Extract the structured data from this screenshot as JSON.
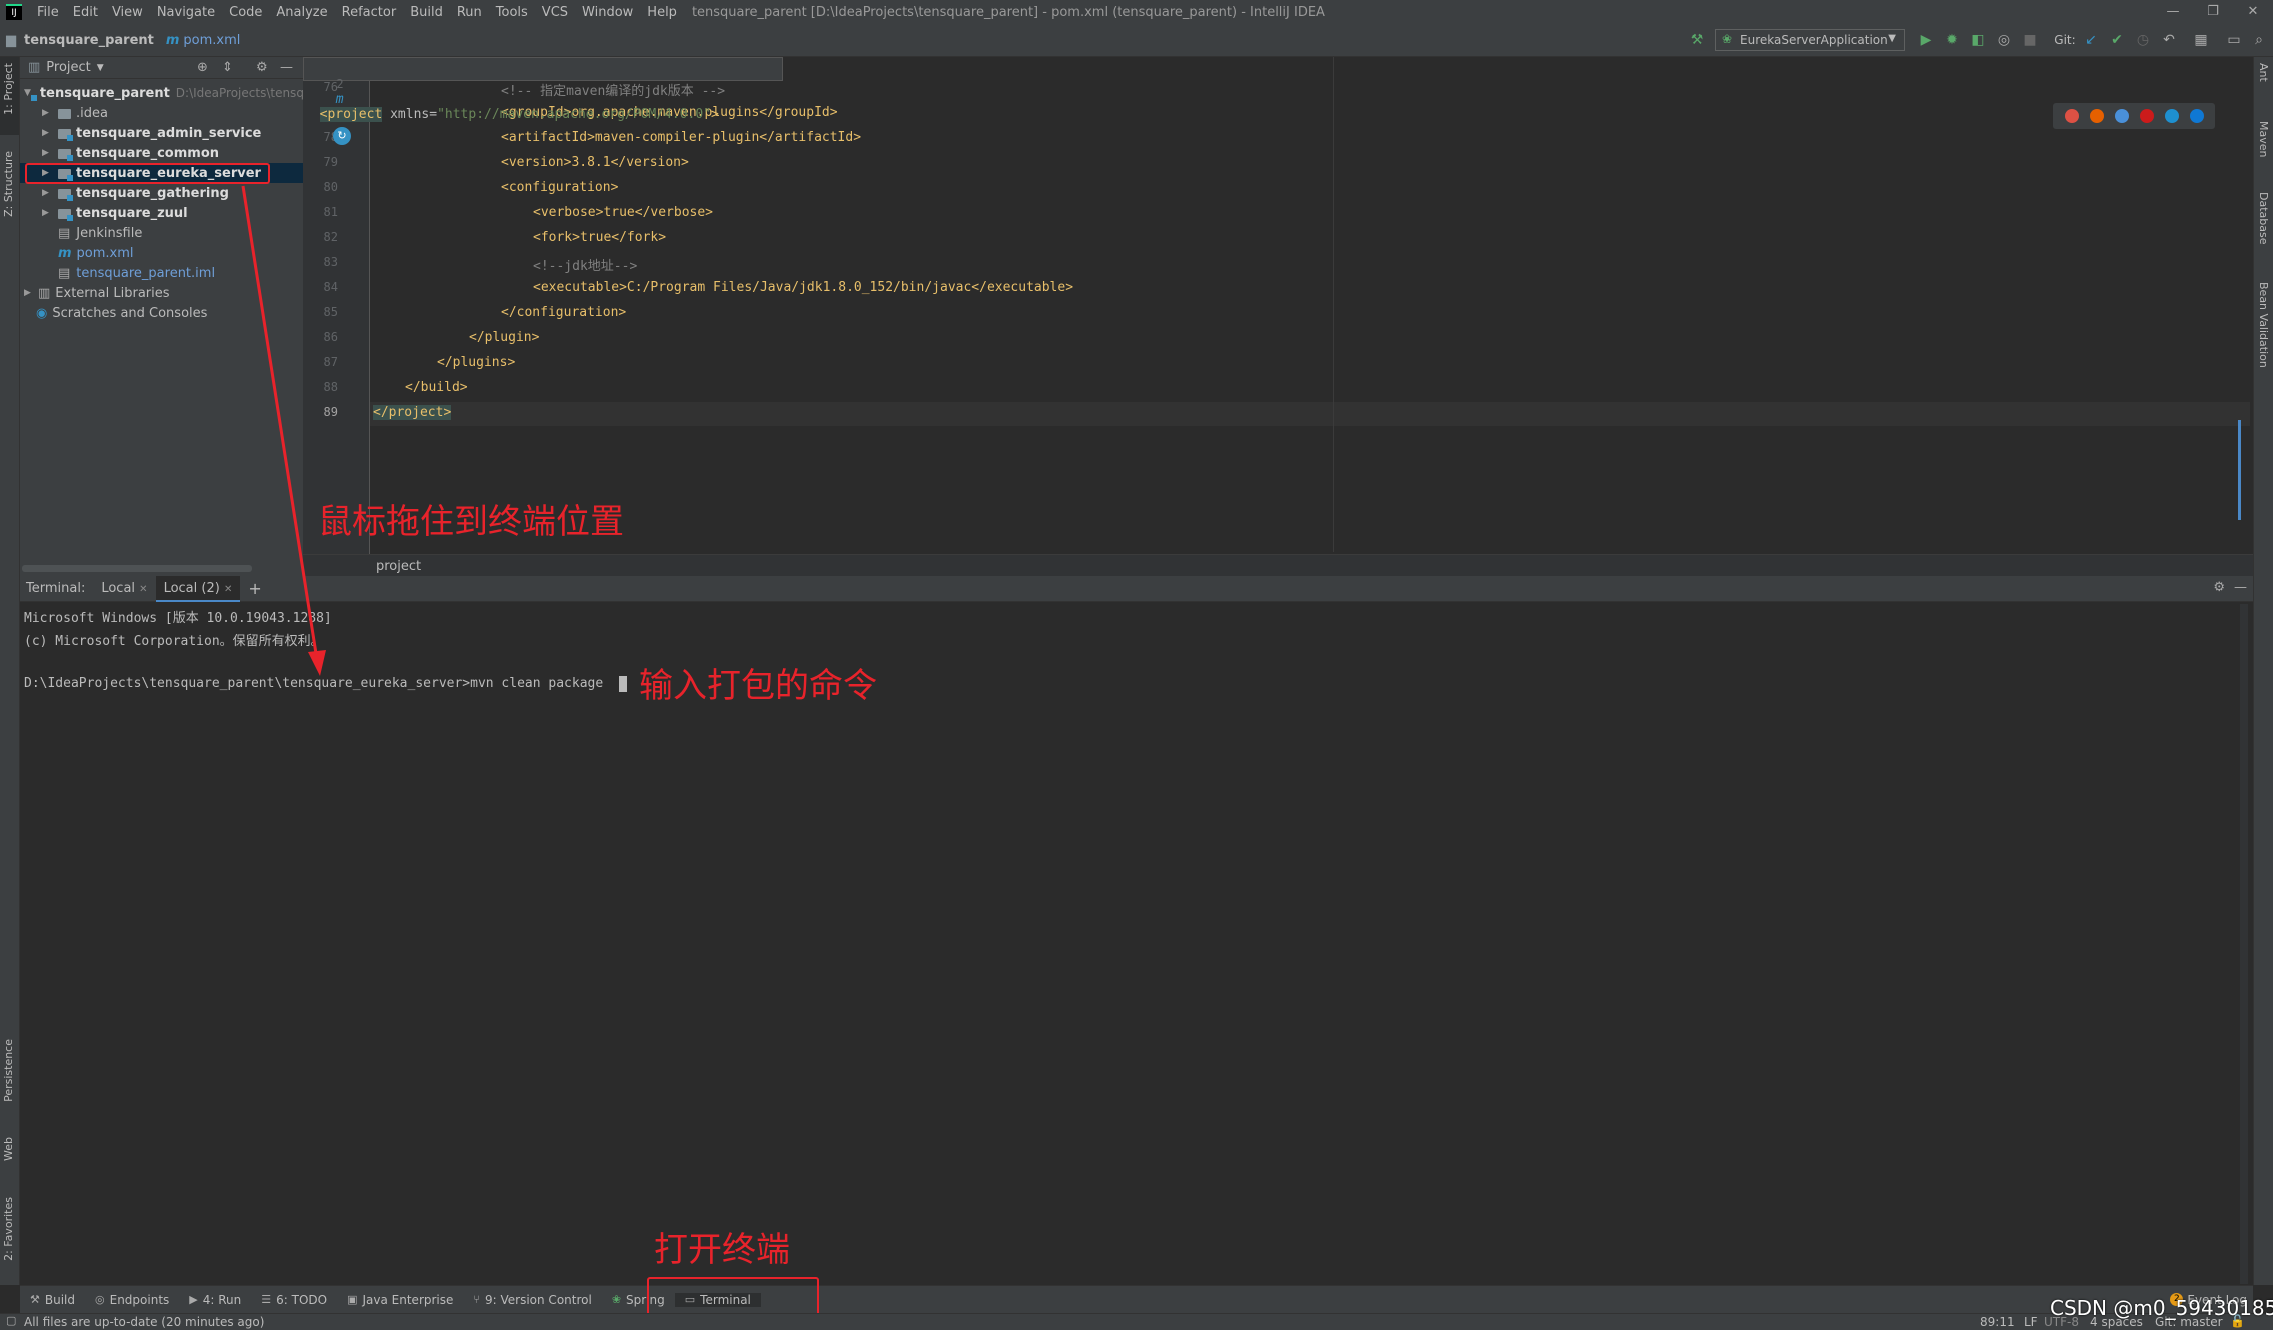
{
  "window": {
    "title": "tensquare_parent [D:\\IdeaProjects\\tensquare_parent] - pom.xml (tensquare_parent) - IntelliJ IDEA",
    "logo": "IJ"
  },
  "menu": [
    "File",
    "Edit",
    "View",
    "Navigate",
    "Code",
    "Analyze",
    "Refactor",
    "Build",
    "Run",
    "Tools",
    "VCS",
    "Window",
    "Help"
  ],
  "nav": {
    "project": "tensquare_parent",
    "file": "pom.xml",
    "run_config": "EurekaServerApplication",
    "git_label": "Git:"
  },
  "left_tabs": {
    "project": "1: Project",
    "structure": "Z: Structure",
    "persistence": "Persistence",
    "web": "Web",
    "favorites": "2: Favorites"
  },
  "right_tabs": {
    "ant": "Ant",
    "maven": "Maven",
    "database": "Database",
    "bean": "Bean Validation"
  },
  "project_panel": {
    "title": "Project",
    "items": [
      {
        "label": "tensquare_parent",
        "path": "D:\\IdeaProjects\\tensqu",
        "bold": true
      },
      {
        "label": ".idea"
      },
      {
        "label": "tensquare_admin_service",
        "bold": true
      },
      {
        "label": "tensquare_common",
        "bold": true
      },
      {
        "label": "tensquare_eureka_server",
        "bold": true
      },
      {
        "label": "tensquare_gathering",
        "bold": true
      },
      {
        "label": "tensquare_zuul",
        "bold": true
      },
      {
        "label": "Jenkinsfile"
      },
      {
        "label": "pom.xml"
      },
      {
        "label": "tensquare_parent.iml"
      },
      {
        "label": "External Libraries"
      },
      {
        "label": "Scratches and Consoles"
      }
    ]
  },
  "editor": {
    "sticky": {
      "ln": "2",
      "open": "<project",
      "attr": " xmlns=",
      "val": "\"http://maven.apache.org/POM/4.0.0\""
    },
    "lines": [
      {
        "n": "76",
        "t": "<!-- 指定maven编译的jdk版本 -->"
      },
      {
        "n": "77",
        "t": "<groupId>org.apache.maven.plugins</groupId>"
      },
      {
        "n": "78",
        "t": "<artifactId>maven-compiler-plugin</artifactId>"
      },
      {
        "n": "79",
        "t": "<version>3.8.1</version>"
      },
      {
        "n": "80",
        "t": "<configuration>"
      },
      {
        "n": "81",
        "t": "<verbose>true</verbose>"
      },
      {
        "n": "82",
        "t": "<fork>true</fork>"
      },
      {
        "n": "83",
        "t": "<!--jdk地址-->"
      },
      {
        "n": "84",
        "t": "<executable>C:/Program Files/Java/jdk1.8.0_152/bin/javac</executable>"
      },
      {
        "n": "85",
        "t": "</configuration>"
      },
      {
        "n": "86",
        "t": "</plugin>"
      },
      {
        "n": "87",
        "t": "</plugins>"
      },
      {
        "n": "88",
        "t": "</build>"
      },
      {
        "n": "89",
        "t": "</project>"
      }
    ],
    "breadcrumb": "project"
  },
  "terminal": {
    "label": "Terminal:",
    "tabs": [
      "Local",
      "Local (2)"
    ],
    "add": "+",
    "lines": [
      "Microsoft Windows [版本 10.0.19043.1288]",
      "(c) Microsoft Corporation。保留所有权利。",
      "",
      "D:\\IdeaProjects\\tensquare_parent\\tensquare_eureka_server>mvn clean package"
    ]
  },
  "annotations": {
    "drag": "鼠标拖住到终端位置",
    "command": "输入打包的命令",
    "open": "打开终端"
  },
  "bottom_tools": [
    {
      "label": "Build",
      "icon": "hammer-icon"
    },
    {
      "label": "Endpoints",
      "icon": "endpoints-icon"
    },
    {
      "label": "4: Run",
      "icon": "run-icon"
    },
    {
      "label": "6: TODO",
      "icon": "todo-icon"
    },
    {
      "label": "Java Enterprise",
      "icon": "java-ee-icon"
    },
    {
      "label": "9: Version Control",
      "icon": "vcs-icon"
    },
    {
      "label": "Spring",
      "icon": "spring-icon"
    },
    {
      "label": "Terminal",
      "icon": "terminal-icon"
    }
  ],
  "event_log": {
    "count": "2",
    "label": "Event Log"
  },
  "status": {
    "message": "All files are up-to-date (20 minutes ago)",
    "position": "89:11",
    "line_sep": "LF",
    "encoding": "UTF-8",
    "indent": "4 spaces",
    "git": "Git: master"
  },
  "watermark": "CSDN @m0_59430185"
}
